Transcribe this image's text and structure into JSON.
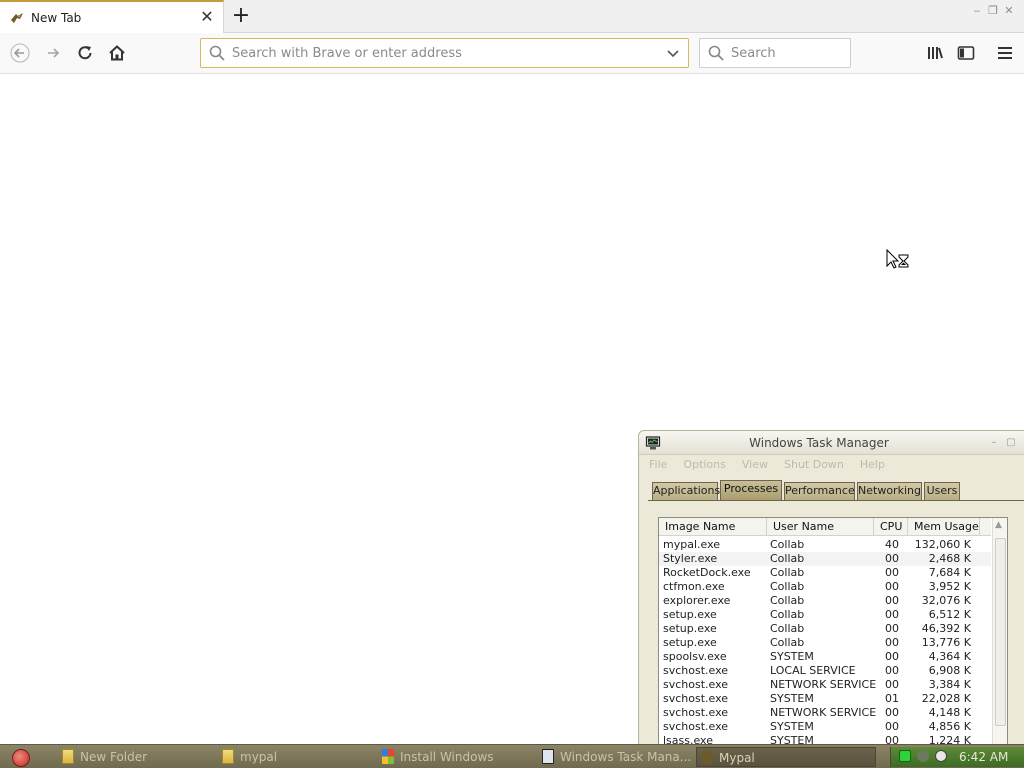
{
  "browser": {
    "tab": {
      "title": "New Tab",
      "close_glyph": "✕"
    },
    "new_tab_glyph": "+",
    "window_controls": {
      "minimize": "‒",
      "restore": "❐",
      "close": "✕"
    },
    "nav": {
      "back_icon": "arrow-left-icon",
      "forward_icon": "arrow-right-icon",
      "reload_icon": "reload-icon",
      "home_icon": "home-icon"
    },
    "address_bar": {
      "value": "",
      "placeholder": "Search with Brave or enter address"
    },
    "search_bar": {
      "value": "",
      "placeholder": "Search"
    },
    "toolbar_icons": [
      "library-icon",
      "sidebar-icon",
      "hamburger-menu-icon"
    ],
    "accent_color": "#d7b85d"
  },
  "task_manager": {
    "title": "Windows Task Manager",
    "menu": [
      "File",
      "Options",
      "View",
      "Shut Down",
      "Help"
    ],
    "tabs": [
      "Applications",
      "Processes",
      "Performance",
      "Networking",
      "Users"
    ],
    "active_tab": "Processes",
    "columns": [
      "Image Name",
      "User Name",
      "CPU",
      "Mem Usage"
    ],
    "rows": [
      {
        "name": "mypal.exe",
        "user": "Collab",
        "cpu": "40",
        "mem": "132,060 K"
      },
      {
        "name": "Styler.exe",
        "user": "Collab",
        "cpu": "00",
        "mem": "2,468 K"
      },
      {
        "name": "RocketDock.exe",
        "user": "Collab",
        "cpu": "00",
        "mem": "7,684 K"
      },
      {
        "name": "ctfmon.exe",
        "user": "Collab",
        "cpu": "00",
        "mem": "3,952 K"
      },
      {
        "name": "explorer.exe",
        "user": "Collab",
        "cpu": "00",
        "mem": "32,076 K"
      },
      {
        "name": "setup.exe",
        "user": "Collab",
        "cpu": "00",
        "mem": "6,512 K"
      },
      {
        "name": "setup.exe",
        "user": "Collab",
        "cpu": "00",
        "mem": "46,392 K"
      },
      {
        "name": "setup.exe",
        "user": "Collab",
        "cpu": "00",
        "mem": "13,776 K"
      },
      {
        "name": "spoolsv.exe",
        "user": "SYSTEM",
        "cpu": "00",
        "mem": "4,364 K"
      },
      {
        "name": "svchost.exe",
        "user": "LOCAL SERVICE",
        "cpu": "00",
        "mem": "6,908 K"
      },
      {
        "name": "svchost.exe",
        "user": "NETWORK SERVICE",
        "cpu": "00",
        "mem": "3,384 K"
      },
      {
        "name": "svchost.exe",
        "user": "SYSTEM",
        "cpu": "01",
        "mem": "22,028 K"
      },
      {
        "name": "svchost.exe",
        "user": "NETWORK SERVICE",
        "cpu": "00",
        "mem": "4,148 K"
      },
      {
        "name": "svchost.exe",
        "user": "SYSTEM",
        "cpu": "00",
        "mem": "4,856 K"
      },
      {
        "name": "lsass.exe",
        "user": "SYSTEM",
        "cpu": "00",
        "mem": "1,224 K"
      }
    ]
  },
  "taskbar": {
    "items": [
      {
        "label": "New Folder",
        "icon": "folder-icon"
      },
      {
        "label": "mypal",
        "icon": "folder-icon"
      },
      {
        "label": "Install Windows",
        "icon": "windows-flag-icon"
      },
      {
        "label": "Windows Task Mana...",
        "icon": "task-manager-icon"
      },
      {
        "label": "Mypal",
        "icon": "mypal-icon"
      }
    ],
    "active_index": 4,
    "clock": "6:42 AM"
  }
}
